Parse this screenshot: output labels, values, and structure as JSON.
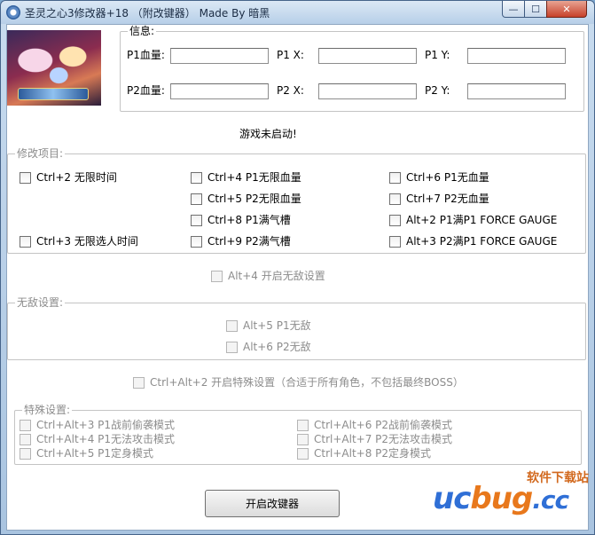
{
  "window": {
    "title": "圣灵之心3修改器+18 （附改键器） Made By 暗黑",
    "min_label": "—",
    "max_label": "☐",
    "close_label": "✕"
  },
  "info": {
    "legend": "信息:",
    "p1_hp_label": "P1血量:",
    "p1_x_label": "P1 X:",
    "p1_y_label": "P1 Y:",
    "p2_hp_label": "P2血量:",
    "p2_x_label": "P2 X:",
    "p2_y_label": "P2 Y:",
    "p1_hp_value": "",
    "p1_x_value": "",
    "p1_y_value": "",
    "p2_hp_value": "",
    "p2_x_value": "",
    "p2_y_value": ""
  },
  "status_text": "游戏未启动!",
  "modify": {
    "legend": "修改项目:",
    "items": [
      "Ctrl+2 无限时间",
      "Ctrl+3 无限选人时间",
      "Ctrl+4 P1无限血量",
      "Ctrl+5 P2无限血量",
      "Ctrl+8 P1满气槽",
      "Ctrl+9 P2满气槽",
      "Ctrl+6 P1无血量",
      "Ctrl+7 P2无血量",
      "Alt+2 P1满P1 FORCE GAUGE",
      "Alt+3 P2满P1 FORCE GAUGE"
    ]
  },
  "invincible_toggle": "Alt+4 开启无敌设置",
  "invincible": {
    "legend": "无敌设置:",
    "items": [
      "Alt+5 P1无敌",
      "Alt+6 P2无敌"
    ]
  },
  "special_toggle": "Ctrl+Alt+2 开启特殊设置（合适于所有角色，不包括最终BOSS）",
  "special": {
    "legend": "特殊设置:",
    "items": [
      "Ctrl+Alt+3 P1战前偷袭模式",
      "Ctrl+Alt+4 P1无法攻击模式",
      "Ctrl+Alt+5 P1定身模式",
      "Ctrl+Alt+6 P2战前偷袭模式",
      "Ctrl+Alt+7 P2无法攻击模式",
      "Ctrl+Alt+8 P2定身模式"
    ]
  },
  "start_button": "开启改键器",
  "watermark": {
    "top": "软件下载站",
    "main_a": "uc",
    "main_b": "bug",
    "main_c": ".cc"
  },
  "colors": {
    "disabled_text": "#8c8c8c",
    "watermark_blue": "#2f6fd6",
    "watermark_orange": "#e8781c"
  }
}
